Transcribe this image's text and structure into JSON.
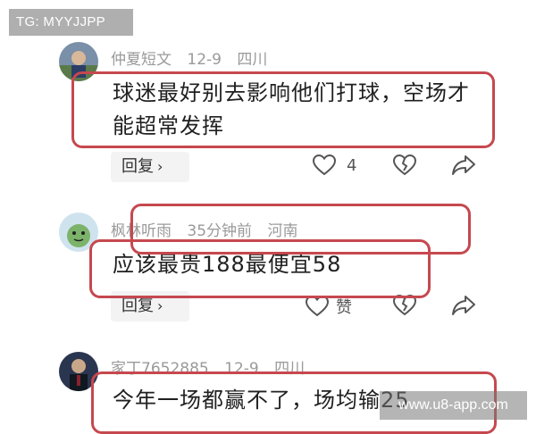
{
  "watermark": {
    "top_left": "TG: MYYJJPP",
    "bottom_right": "www.u8-app.com"
  },
  "comments": [
    {
      "username": "仲夏短文",
      "date": "12-9",
      "location": "四川",
      "text": "球迷最好别去影响他们打球，空场才能超常发挥",
      "reply_label": "回复",
      "like_count": "4"
    },
    {
      "username": "枫林听雨",
      "date": "35分钟前",
      "location": "河南",
      "text": "应该最贵188最便宜58",
      "reply_label": "回复",
      "like_label": "赞"
    },
    {
      "username": "家丁7652885",
      "date": "12-9",
      "location": "四川",
      "text": "今年一场都赢不了，场均输25"
    }
  ],
  "colors": {
    "highlight_border": "#c6484f",
    "meta_gray": "#9a9a9a"
  },
  "icons": [
    "chevron-right-icon",
    "heart-icon",
    "broken-heart-icon",
    "share-icon"
  ]
}
